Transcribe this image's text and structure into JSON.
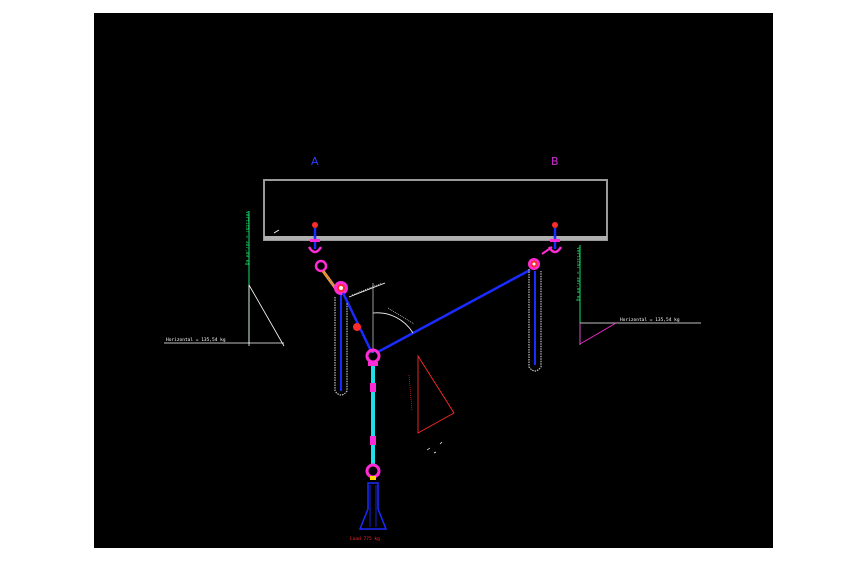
{
  "colors": {
    "background": "#000000",
    "page": "#ffffff",
    "beam": "#9a9a9a",
    "rigging": "#1a2bff",
    "hoist_line": "#1fe0e6",
    "hardware": "#ff2bd6",
    "load_text": "#ff2a2a",
    "vertical_dim": "#18e06a",
    "label_A": "#2e40ff",
    "label_B": "#d22bd6"
  },
  "points": {
    "a_label": "A",
    "b_label": "B"
  },
  "forces": {
    "horizontal_left": "Horizontal = 135,54 kg",
    "horizontal_right": "Horizontal = 135,54 kg",
    "vertical_left": "Vertical = 387,89 kg",
    "vertical_right": "Vertical = 387,89 kg"
  },
  "load": {
    "label": "Load 775 kg"
  },
  "icons": {
    "shackle": "shackle-icon",
    "hook": "hook-icon",
    "hoist": "chain-hoist-icon",
    "load_block": "load-block-icon"
  }
}
